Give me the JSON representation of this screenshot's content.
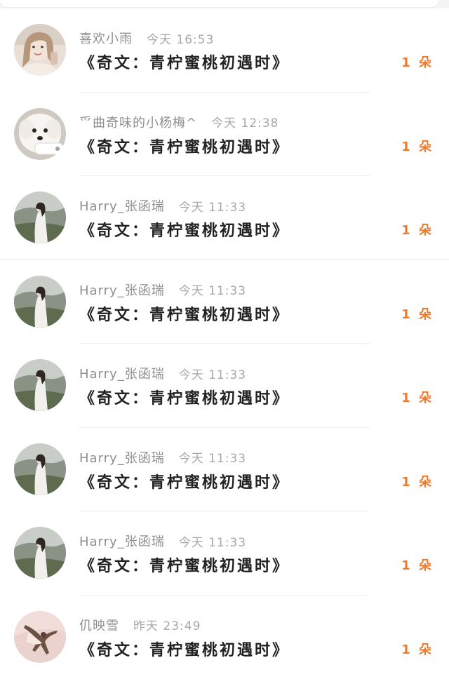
{
  "accent": "#f07a2c",
  "messages": [
    {
      "name": "喜欢小雨",
      "time": "今天 16:53",
      "gift": "《奇文：青柠蜜桃初遇时》",
      "count": "1 朵",
      "avatar": "girl-selfie-avatar"
    },
    {
      "name": "爫曲奇味的小杨梅^",
      "time": "今天 12:38",
      "gift": "《奇文：青柠蜜桃初遇时》",
      "count": "1 朵",
      "avatar": "white-dog-avatar"
    },
    {
      "name": "Harry_张函瑞",
      "time": "今天 11:33",
      "gift": "《奇文：青柠蜜桃初遇时》",
      "count": "1 朵",
      "avatar": "girl-landscape-avatar"
    },
    {
      "name": "Harry_张函瑞",
      "time": "今天 11:33",
      "gift": "《奇文：青柠蜜桃初遇时》",
      "count": "1 朵",
      "avatar": "girl-landscape-avatar"
    },
    {
      "name": "Harry_张函瑞",
      "time": "今天 11:33",
      "gift": "《奇文：青柠蜜桃初遇时》",
      "count": "1 朵",
      "avatar": "girl-landscape-avatar"
    },
    {
      "name": "Harry_张函瑞",
      "time": "今天 11:33",
      "gift": "《奇文：青柠蜜桃初遇时》",
      "count": "1 朵",
      "avatar": "girl-landscape-avatar"
    },
    {
      "name": "Harry_张函瑞",
      "time": "今天 11:33",
      "gift": "《奇文：青柠蜜桃初遇时》",
      "count": "1 朵",
      "avatar": "girl-landscape-avatar"
    },
    {
      "name": "仉映雪",
      "time": "昨天 23:49",
      "gift": "《奇文：青柠蜜桃初遇时》",
      "count": "1 朵",
      "avatar": "dancer-avatar"
    }
  ]
}
